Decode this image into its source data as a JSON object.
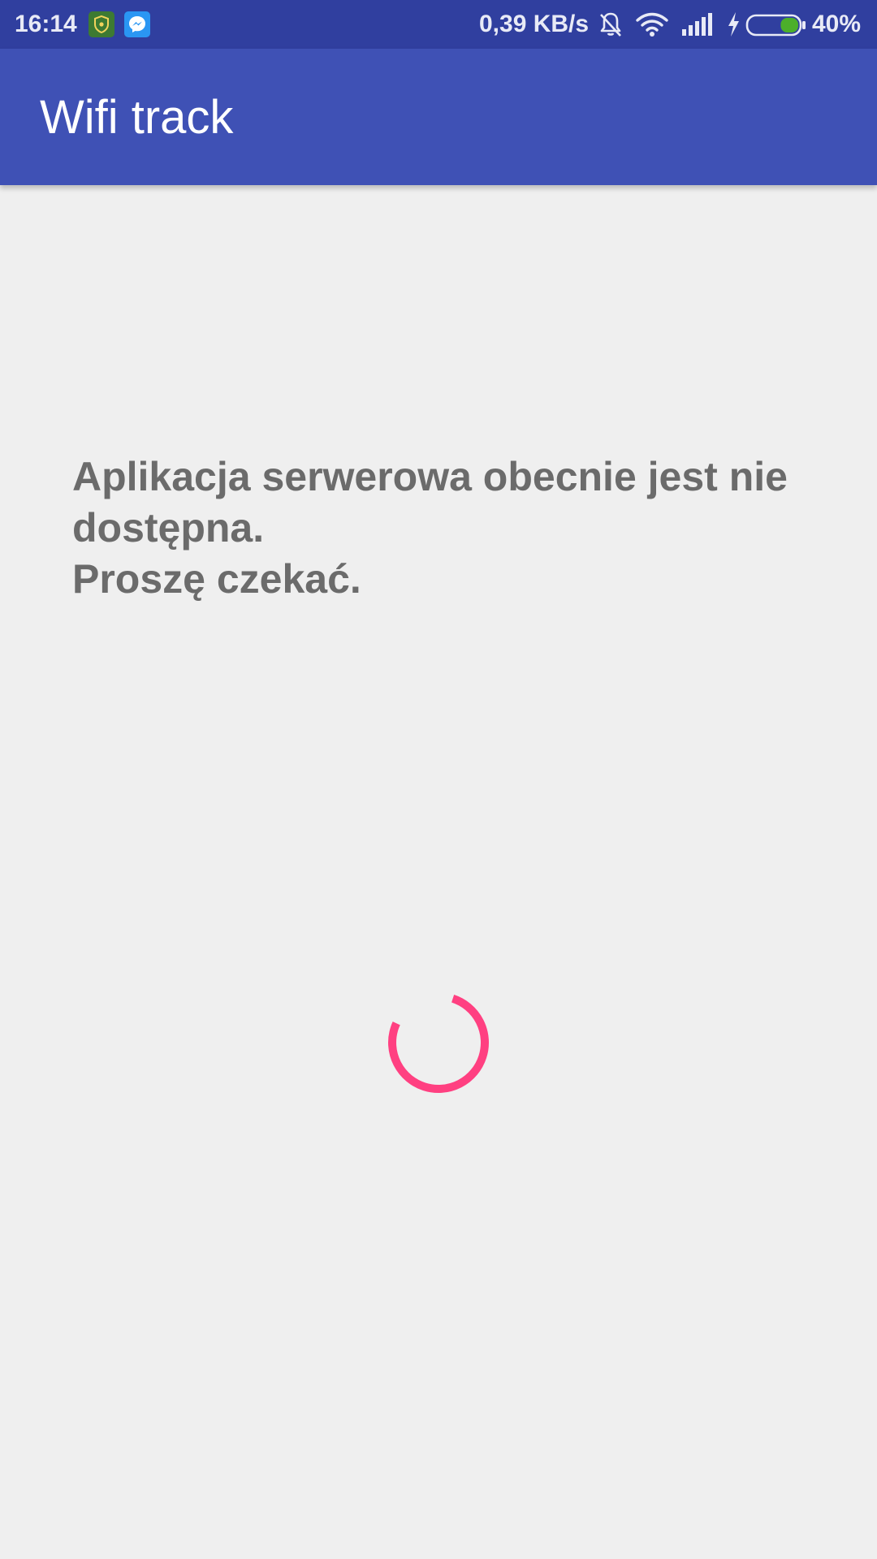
{
  "status_bar": {
    "time": "16:14",
    "network_speed": "0,39 KB/s",
    "battery_percent": "40%",
    "battery_level": 0.4,
    "notification_icons": [
      "shield-icon",
      "messenger-icon"
    ],
    "system_icons": [
      "bell-muted-icon",
      "wifi-icon",
      "signal-icon",
      "charging-icon",
      "battery-icon"
    ]
  },
  "app_bar": {
    "title": "Wifi track",
    "color": "#3f51b5"
  },
  "main": {
    "message": "Aplikacja serwerowa obecnie jest nie dostępna.\nProszę czekać."
  },
  "spinner": {
    "color": "#ff4081"
  }
}
